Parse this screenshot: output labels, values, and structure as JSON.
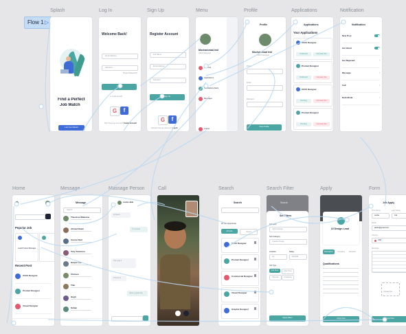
{
  "flow": {
    "label": "Flow 1",
    "arrow": "▷"
  },
  "titles": [
    "Splash",
    "Log In",
    "Sign Up",
    "Menu",
    "Profile",
    "Applications",
    "Notification",
    "Home",
    "Message",
    "Massage Person",
    "Call",
    "Search",
    "Search Filter",
    "Apply",
    "Form"
  ],
  "splash": {
    "headline_1": "Find a Perfect",
    "headline_2": "Job Match",
    "button": "Let's Get Started"
  },
  "login": {
    "heading": "Welcome Back!",
    "field_1": "Email Address",
    "field_2": "Password",
    "forgot": "Forgot Password?",
    "button": "Log In",
    "divider": "or continue with",
    "signup_prompt": "Don't have an account?",
    "signup_link": "Create Account"
  },
  "signup": {
    "heading": "Register Account",
    "field_1": "Full Name",
    "field_2": "Email Address",
    "field_3": "Password",
    "button": "Sign Up",
    "login_prompt": "Already have an account?",
    "login_link": "Log In"
  },
  "menu": {
    "name": "Mochammad Irsil",
    "role": "UI/UX Designer",
    "items": [
      "Job Post",
      "Applications",
      "Notifications Alerts",
      "Messages"
    ],
    "logout": "Logout"
  },
  "profile": {
    "title": "Profile",
    "name": "Mochammad Irsil",
    "role": "UI/UX Designer",
    "labels": [
      "Phone",
      "Email",
      "Password"
    ],
    "button": "Save Profile"
  },
  "applications": {
    "title": "Applications",
    "heading": "Your Applications",
    "jobs": [
      {
        "title": "UI/UX Designer",
        "status_1": "Delivered",
        "status_2": "Interview Set",
        "c1": "#4aa5a3",
        "c2": "#4aa5a3"
      },
      {
        "title": "Product Designer",
        "status_1": "Delivered",
        "status_2": "Interview Set",
        "c1": "#4aa5a3",
        "c2": "#e35a6f"
      },
      {
        "title": "UI/UX Designer",
        "status_1": "Pending",
        "status_2": "Interview Set",
        "c1": "#4aa5a3",
        "c2": "#e35a6f"
      },
      {
        "title": "Product Designer",
        "status_1": "Pending",
        "status_2": "Interview Set",
        "c1": "#4aa5a3",
        "c2": "#e35a6f"
      }
    ]
  },
  "notification": {
    "title": "Notification",
    "items": [
      "New Post",
      "Got Hired",
      "Get Rejected",
      "Message",
      "Call",
      "Dark Mode"
    ]
  },
  "home": {
    "section_1": "Popular Job",
    "job_1": "Lead Product Manager",
    "section_2": "Recent Post",
    "recent": [
      "UI/UX Designer",
      "Product Designer",
      "Visual Designer"
    ]
  },
  "message": {
    "title": "Message",
    "search": "Search",
    "contacts": [
      "Theodore Makerzie",
      "Ahmed Dawn",
      "Cassie Dent",
      "Tony Solomon",
      "Harper Lee",
      "Chelsea",
      "Tifer",
      "Hugh",
      "Kahan"
    ]
  },
  "massage_person": {
    "contact": "Leonie Jade",
    "msg_1": "Hi there!",
    "msg_2": "I'm Leonie",
    "msg_3": "Yes I got it",
    "msg_4": "I'd love to",
    "msg_5": "Have a great day"
  },
  "search": {
    "title": "Search",
    "tabs": [
      "All Jobs",
      "Saved"
    ],
    "count": "20 Job Opportunity",
    "jobs": [
      "UI/UX Designer",
      "Product Designer",
      "Commercial Designer",
      "Visual Designer",
      "Graphic Designer"
    ]
  },
  "search_filter": {
    "title": "Search",
    "heading": "Set Filters",
    "labels": [
      "Category",
      "Sub Category",
      "Location",
      "Salary",
      "Job Type"
    ],
    "values": [
      "UI/UX Design",
      "Creative Design",
      "All",
      "$1k-$3k"
    ],
    "job_types": [
      "Full Time",
      "Part Time",
      "Remote",
      "Freelance"
    ],
    "button": "Apply Filters"
  },
  "apply": {
    "title": "UI Design Lead",
    "tabs": [
      "Description",
      "Company",
      "Reviews"
    ],
    "section": "Qualifications",
    "button": "Apply Now"
  },
  "form": {
    "title": "Job Apply",
    "fields": [
      "First Name",
      "Last Name",
      "Email",
      "Country",
      "Message"
    ],
    "values": [
      "Jackie",
      "Irsil",
      "jackie@gmail.com",
      "USA"
    ],
    "upload": "Upload File",
    "button": "Apply Now"
  },
  "colors": {
    "teal": "#4aa5a3",
    "red": "#e35a6f",
    "blue": "#3f6bd6",
    "flow_line": "#b9d8f2",
    "node": "#ffffff"
  }
}
